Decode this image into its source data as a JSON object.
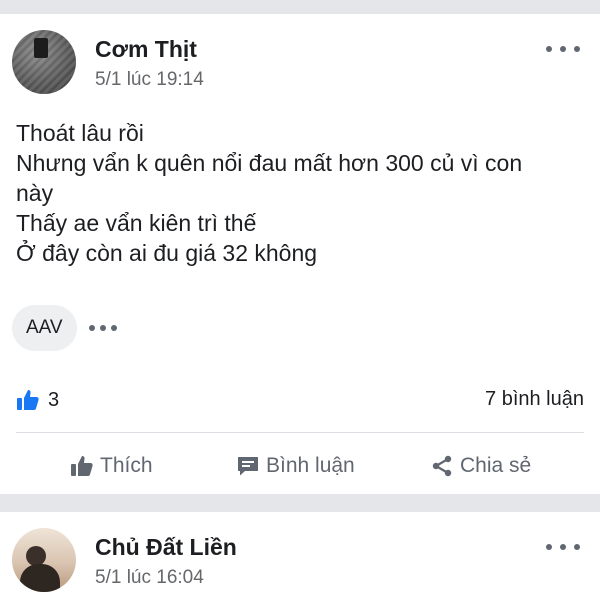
{
  "posts": [
    {
      "author": "Cơm Thịt",
      "time": "5/1 lúc 19:14",
      "content_lines": [
        "Thoát lâu rồi",
        "Nhưng vẩn k quên nổi đau mất hơn 300 củ vì con",
        "này",
        "Thấy ae vẩn kiên trì thế",
        "Ở đây còn ai đu giá 32 không"
      ],
      "tag": "AAV",
      "like_count": "3",
      "comment_count": "7 bình luận",
      "actions": {
        "like": "Thích",
        "comment": "Bình luận",
        "share": "Chia sẻ"
      }
    },
    {
      "author": "Chủ Đất Liền",
      "time": "5/1 lúc 16:04"
    }
  ],
  "icons": {
    "like": "thumbs-up-icon",
    "comment": "comment-bubble-icon",
    "share": "share-icon",
    "more": "more-dots-icon"
  },
  "colors": {
    "like_accent": "#1877f2",
    "muted": "#606770",
    "separator": "#e4e6e9"
  }
}
